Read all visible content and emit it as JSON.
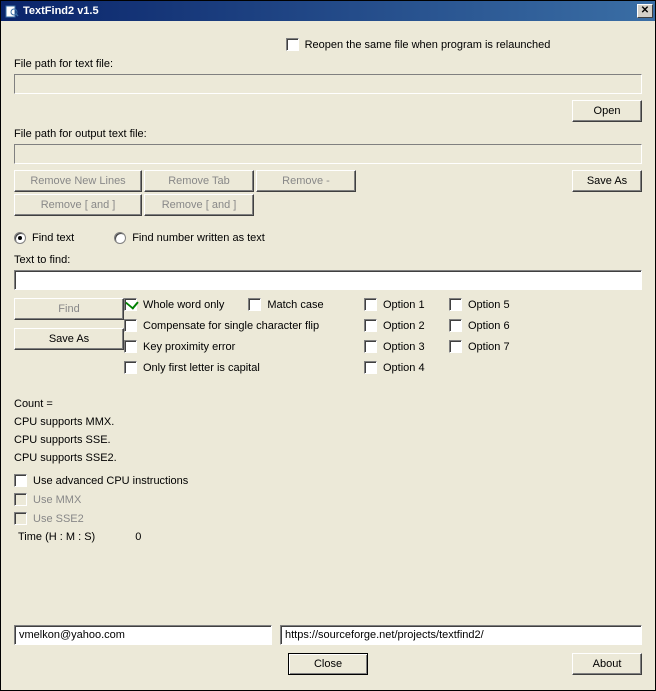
{
  "title": "TextFind2 v1.5",
  "top": {
    "reopen_label": "Reopen the same file when program is relaunched",
    "reopen_checked": false,
    "input_path_label": "File path for text file:",
    "input_path_value": "",
    "open_button": "Open",
    "output_path_label": "File path for output text file:",
    "output_path_value": "",
    "save_as_button": "Save As"
  },
  "strip_buttons": {
    "remove_newlines": "Remove New Lines",
    "remove_tab": "Remove Tab",
    "remove_dash": "Remove -",
    "remove_brackets1": "Remove [ and ]",
    "remove_brackets2": "Remove [ and ]"
  },
  "mode": {
    "find_text_label": "Find text",
    "find_number_label": "Find number written as text",
    "selected": "find_text"
  },
  "find": {
    "text_to_find_label": "Text to find:",
    "text_value": "",
    "find_button": "Find",
    "save_as_button": "Save As"
  },
  "options": {
    "whole_word": {
      "label": "Whole word only",
      "checked": true
    },
    "compensate": {
      "label": "Compensate for single character flip",
      "checked": false
    },
    "key_proximity": {
      "label": "Key proximity error",
      "checked": false
    },
    "first_capital": {
      "label": "Only first letter is capital",
      "checked": false
    },
    "match_case": {
      "label": "Match case",
      "checked": false
    },
    "opt1": {
      "label": "Option 1",
      "checked": false
    },
    "opt2": {
      "label": "Option 2",
      "checked": false
    },
    "opt3": {
      "label": "Option 3",
      "checked": false
    },
    "opt4": {
      "label": "Option 4",
      "checked": false
    },
    "opt5": {
      "label": "Option 5",
      "checked": false
    },
    "opt6": {
      "label": "Option 6",
      "checked": false
    },
    "opt7": {
      "label": "Option 7",
      "checked": false
    }
  },
  "status": {
    "count": "Count =",
    "mmx": "CPU supports MMX.",
    "sse": "CPU supports SSE.",
    "sse2": "CPU supports SSE2."
  },
  "cpu_checks": {
    "advanced": {
      "label": "Use advanced CPU instructions",
      "checked": false
    },
    "use_mmx": {
      "label": "Use MMX",
      "checked": false
    },
    "use_sse2": {
      "label": "Use SSE2",
      "checked": false
    }
  },
  "time": {
    "label": "Time (H : M : S)",
    "value": "0"
  },
  "footer": {
    "email": "vmelkon@yahoo.com",
    "url": "https://sourceforge.net/projects/textfind2/",
    "close": "Close",
    "about": "About"
  }
}
